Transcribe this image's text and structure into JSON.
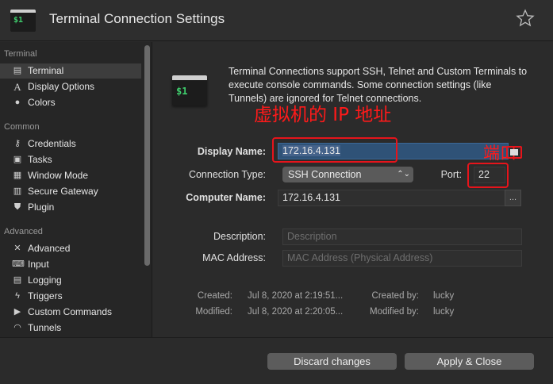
{
  "window": {
    "title": "Terminal Connection Settings",
    "app_icon_text": "$1"
  },
  "sidebar": {
    "sections": [
      {
        "label": "Terminal",
        "items": [
          {
            "label": "Terminal",
            "icon": "terminal-icon",
            "selected": true
          },
          {
            "label": "Display Options",
            "icon": "font-icon"
          },
          {
            "label": "Colors",
            "icon": "palette-icon"
          }
        ]
      },
      {
        "label": "Common",
        "items": [
          {
            "label": "Credentials",
            "icon": "key-icon"
          },
          {
            "label": "Tasks",
            "icon": "tasks-icon"
          },
          {
            "label": "Window Mode",
            "icon": "window-icon"
          },
          {
            "label": "Secure Gateway",
            "icon": "gateway-icon"
          },
          {
            "label": "Plugin",
            "icon": "shield-icon"
          }
        ]
      },
      {
        "label": "Advanced",
        "items": [
          {
            "label": "Advanced",
            "icon": "tools-icon"
          },
          {
            "label": "Input",
            "icon": "keyboard-icon"
          },
          {
            "label": "Logging",
            "icon": "log-icon"
          },
          {
            "label": "Triggers",
            "icon": "triggers-icon"
          },
          {
            "label": "Custom Commands",
            "icon": "commands-icon"
          },
          {
            "label": "Tunnels",
            "icon": "tunnel-icon"
          }
        ]
      }
    ]
  },
  "main": {
    "icon_text": "$1",
    "info": "Terminal Connections support SSH, Telnet and Custom Terminals to execute console commands. Some connection settings (like Tunnels) are ignored for Telnet connections.",
    "annotation_ip": "虚拟机的 IP 地址",
    "annotation_port": "端口",
    "display_name": {
      "label": "Display Name:",
      "value": "172.16.4.131"
    },
    "connection_type": {
      "label": "Connection Type:",
      "value": "SSH Connection"
    },
    "port": {
      "label": "Port:",
      "value": "22"
    },
    "computer_name": {
      "label": "Computer Name:",
      "value": "172.16.4.131",
      "browse": "..."
    },
    "description": {
      "label": "Description:",
      "placeholder": "Description"
    },
    "mac_address": {
      "label": "MAC Address:",
      "placeholder": "MAC Address (Physical Address)"
    },
    "meta": {
      "created_label": "Created:",
      "created_value": "Jul 8, 2020 at 2:19:51...",
      "modified_label": "Modified:",
      "modified_value": "Jul 8, 2020 at 2:20:05...",
      "created_by_label": "Created by:",
      "created_by_value": "lucky",
      "modified_by_label": "Modified by:",
      "modified_by_value": "lucky"
    }
  },
  "footer": {
    "discard": "Discard changes",
    "apply": "Apply & Close"
  },
  "colors": {
    "annotation": "#e6141b",
    "accent": "#2f5277",
    "prompt_green": "#3fce6d"
  }
}
